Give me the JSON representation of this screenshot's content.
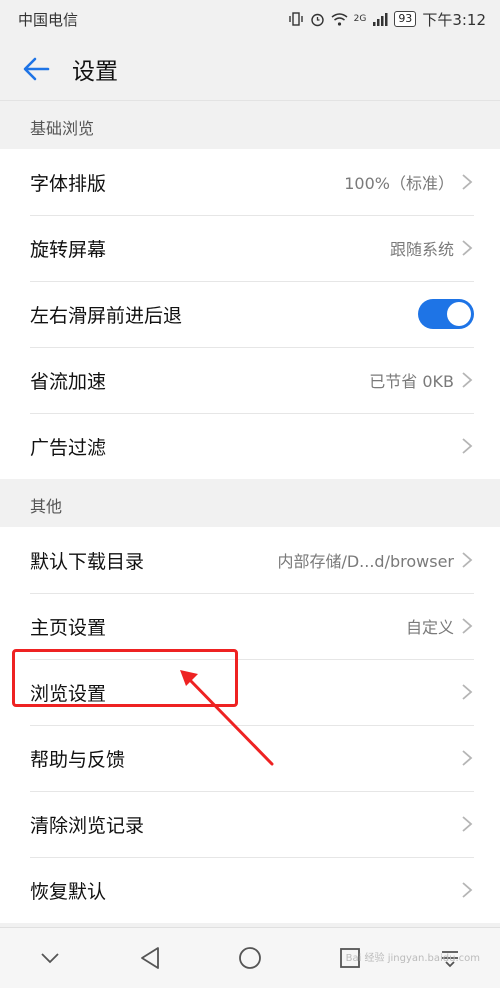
{
  "status_bar": {
    "carrier": "中国电信",
    "battery": "93",
    "time": "下午3:12",
    "icons": [
      "vibrate-icon",
      "alarm-icon",
      "wifi-icon",
      "signal-icon"
    ],
    "network_label": "2G"
  },
  "header": {
    "title": "设置",
    "back_icon": "back-arrow-icon"
  },
  "sections": [
    {
      "header": "基础浏览",
      "items": [
        {
          "label": "字体排版",
          "value": "100%（标准）",
          "chevron": true
        },
        {
          "label": "旋转屏幕",
          "value": "跟随系统",
          "chevron": true
        },
        {
          "label": "左右滑屏前进后退",
          "toggle": true,
          "toggle_on": true
        },
        {
          "label": "省流加速",
          "value": "已节省 0KB",
          "chevron": true
        },
        {
          "label": "广告过滤",
          "value": "",
          "chevron": true
        }
      ]
    },
    {
      "header": "其他",
      "items": [
        {
          "label": "默认下载目录",
          "value": "内部存储/D...d/browser",
          "chevron": true
        },
        {
          "label": "主页设置",
          "value": "自定义",
          "chevron": true
        },
        {
          "label": "浏览设置",
          "value": "",
          "chevron": true,
          "highlighted": true
        },
        {
          "label": "帮助与反馈",
          "value": "",
          "chevron": true
        },
        {
          "label": "清除浏览记录",
          "value": "",
          "chevron": true
        },
        {
          "label": "恢复默认",
          "value": "",
          "chevron": true
        }
      ]
    }
  ],
  "nav_bar": {
    "icons": [
      "hide-nav-icon",
      "back-triangle-icon",
      "home-circle-icon",
      "recents-square-icon",
      "notification-pull-icon"
    ]
  },
  "colors": {
    "accent": "#1e74e6",
    "highlight": "#ee2222",
    "background": "#f1f1f1"
  },
  "watermark": "Bai 经验 jingyan.baidu.com"
}
